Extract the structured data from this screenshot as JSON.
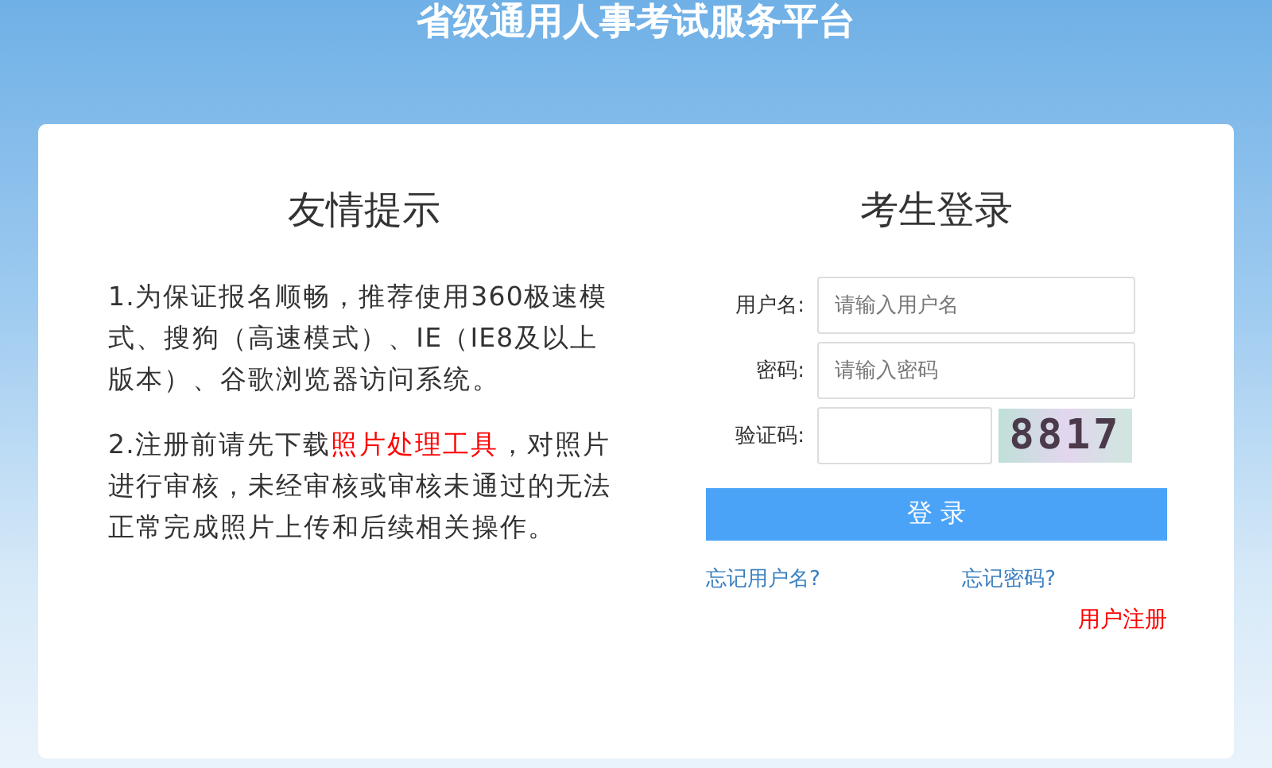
{
  "header": {
    "title": "省级通用人事考试服务平台"
  },
  "notice": {
    "title": "友情提示",
    "paragraphs": [
      {
        "text": "1.为保证报名顺畅，推荐使用360极速模式、搜狗（高速模式）、IE（IE8及以上版本）、谷歌浏览器访问系统。"
      },
      {
        "text": "2.注册前请先下载",
        "link": "照片处理工具",
        "after": "，对照片进行审核，未经审核或审核未通过的无法正常完成照片上传和后续相关操作。"
      }
    ]
  },
  "login": {
    "title": "考生登录",
    "fields": [
      {
        "kind": "text",
        "label": "用户名:",
        "placeholder": "请输入用户名"
      },
      {
        "kind": "password",
        "label": "密码:",
        "placeholder": "请输入密码"
      },
      {
        "kind": "captcha",
        "label": "验证码:",
        "captcha": "8817"
      }
    ],
    "button": "登 录",
    "links": [
      "忘记用户名?",
      "忘记密码?"
    ],
    "register": "用户注册"
  }
}
